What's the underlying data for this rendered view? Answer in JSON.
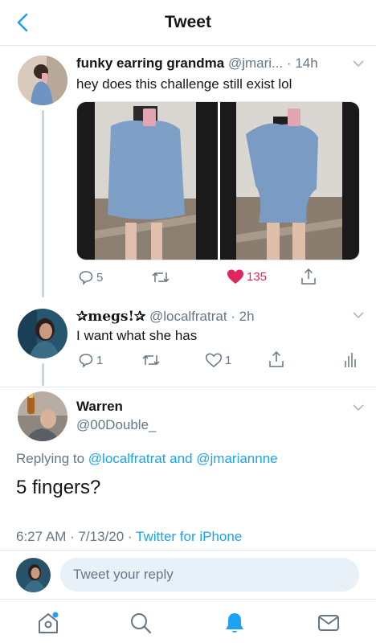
{
  "header": {
    "title": "Tweet"
  },
  "tweet1": {
    "name": "funky earring grandma",
    "handle_time": "@jmari... · 14h",
    "text": "hey does this challenge still exist lol",
    "replies": "5",
    "likes": "135"
  },
  "tweet2": {
    "name": "✰megs!✰",
    "handle_time": "@localfratrat · 2h",
    "text": "I want what she has",
    "replies": "1",
    "likes": "1"
  },
  "tweet3": {
    "name": "Warren",
    "handle": "@00Double_",
    "replying_prefix": "Replying to",
    "replying_user1": "@localfratrat",
    "replying_and": "and",
    "replying_user2": "@jmariannne",
    "text": "5 fingers?",
    "timestamp": "6:27 AM · 7/13/20 ·",
    "source": "Twitter for iPhone"
  },
  "reply_bar": {
    "placeholder": "Tweet your reply"
  },
  "colors": {
    "accent": "#1da1f2",
    "like": "#e0245e",
    "secondary": "#657786",
    "divider": "#e1e8ed"
  },
  "tabbar": {
    "icons": [
      "home-icon",
      "search-icon",
      "notifications-icon",
      "messages-icon"
    ]
  }
}
